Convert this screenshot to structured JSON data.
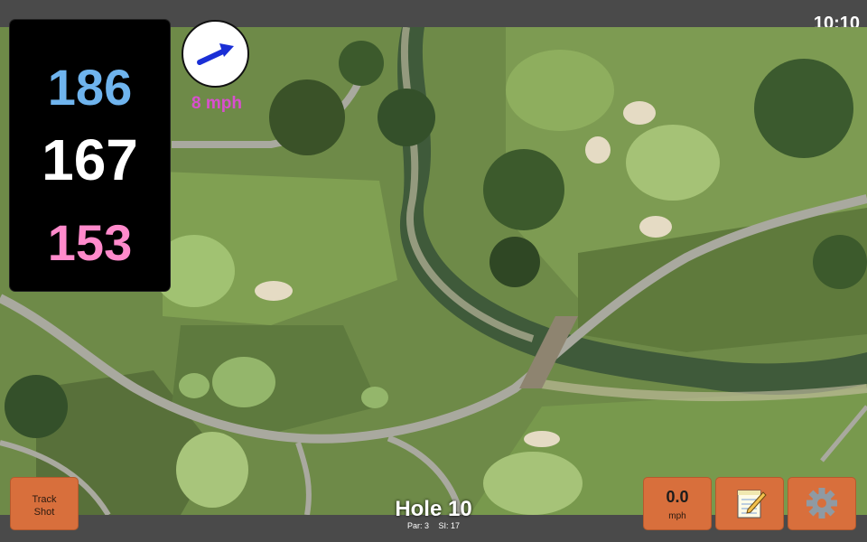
{
  "status": {
    "time": "10:10"
  },
  "distances": {
    "back": "186",
    "middle": "167",
    "front": "153"
  },
  "wind": {
    "speed": "8 mph",
    "icon": "wind-arrow-icon"
  },
  "buttons": {
    "track_shot_line1": "Track",
    "track_shot_line2": "Shot",
    "speed_value": "0.0",
    "speed_unit": "mph",
    "notes_icon": "notepad-icon",
    "settings_icon": "gear-icon"
  },
  "hole": {
    "title": "Hole 10",
    "par": "Par: 3",
    "si": "SI: 17"
  },
  "colors": {
    "back": "#6fb4ee",
    "middle": "#ffffff",
    "front": "#ff8acb",
    "wind_text": "#d94fcf",
    "button": "#d86f3c",
    "bar": "#4a4a4a"
  }
}
